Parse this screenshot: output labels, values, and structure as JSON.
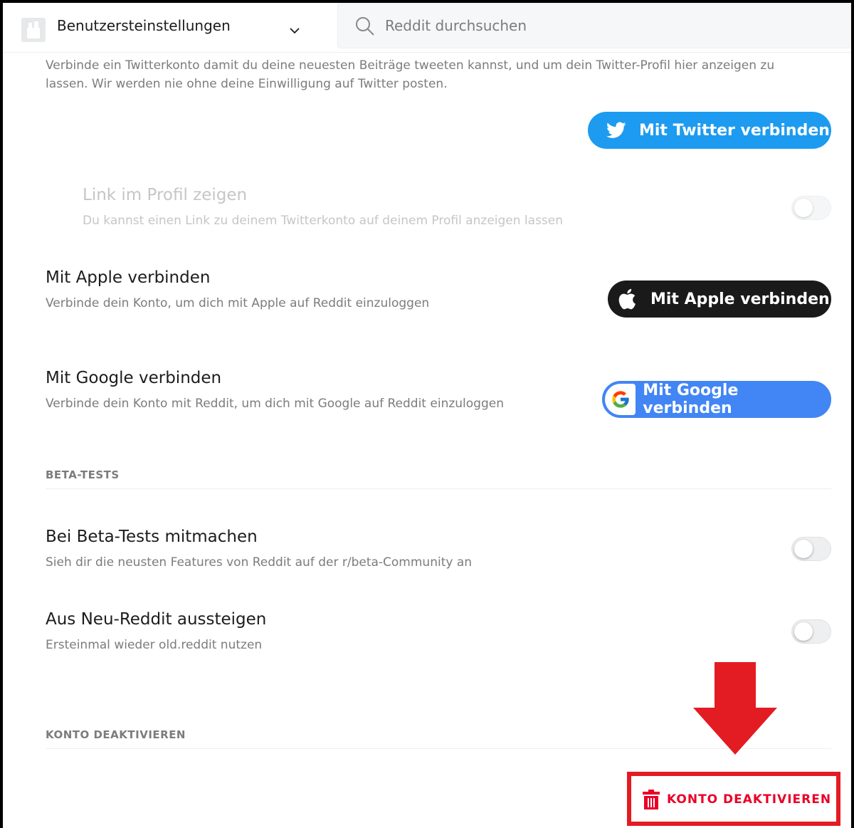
{
  "header": {
    "title": "Benutzersteinstellungen",
    "search_placeholder": "Reddit durchsuchen"
  },
  "twitter": {
    "description": "Verbinde ein Twitterkonto damit du deine neuesten Beiträge tweeten kannst, und um dein Twitter-Profil hier anzeigen zu lassen. Wir werden nie ohne deine Einwilligung auf Twitter posten.",
    "button_label": "Mit Twitter verbinden",
    "brand_color": "#1d9bf0"
  },
  "link_profile": {
    "title": "Link im Profil zeigen",
    "subtitle": "Du kannst einen Link zu deinem Twitterkonto auf deinem Profil anzeigen lassen",
    "enabled": false,
    "disabled": true
  },
  "apple": {
    "title": "Mit Apple verbinden",
    "subtitle": "Verbinde dein Konto, um dich mit Apple auf Reddit einzuloggen",
    "button_label": "Mit Apple verbinden"
  },
  "google": {
    "title": "Mit Google verbinden",
    "subtitle": "Verbinde dein Konto mit Reddit, um dich mit Google auf Reddit einzuloggen",
    "button_label": "Mit Google verbinden",
    "brand_color": "#4285f4"
  },
  "beta_section": {
    "label": "BETA-TESTS",
    "items": [
      {
        "title": "Bei Beta-Tests mitmachen",
        "subtitle": "Sieh dir die neusten Features von Reddit auf der r/beta-Community an",
        "enabled": false
      },
      {
        "title": "Aus Neu-Reddit aussteigen",
        "subtitle": "Ersteinmal wieder old.reddit nutzen",
        "enabled": false
      }
    ]
  },
  "deactivate_section": {
    "label": "KONTO DEAKTIVIEREN",
    "button_label": "KONTO DEAKTIVIEREN",
    "danger_color": "#ea0027",
    "highlight_color": "#e31b23"
  }
}
